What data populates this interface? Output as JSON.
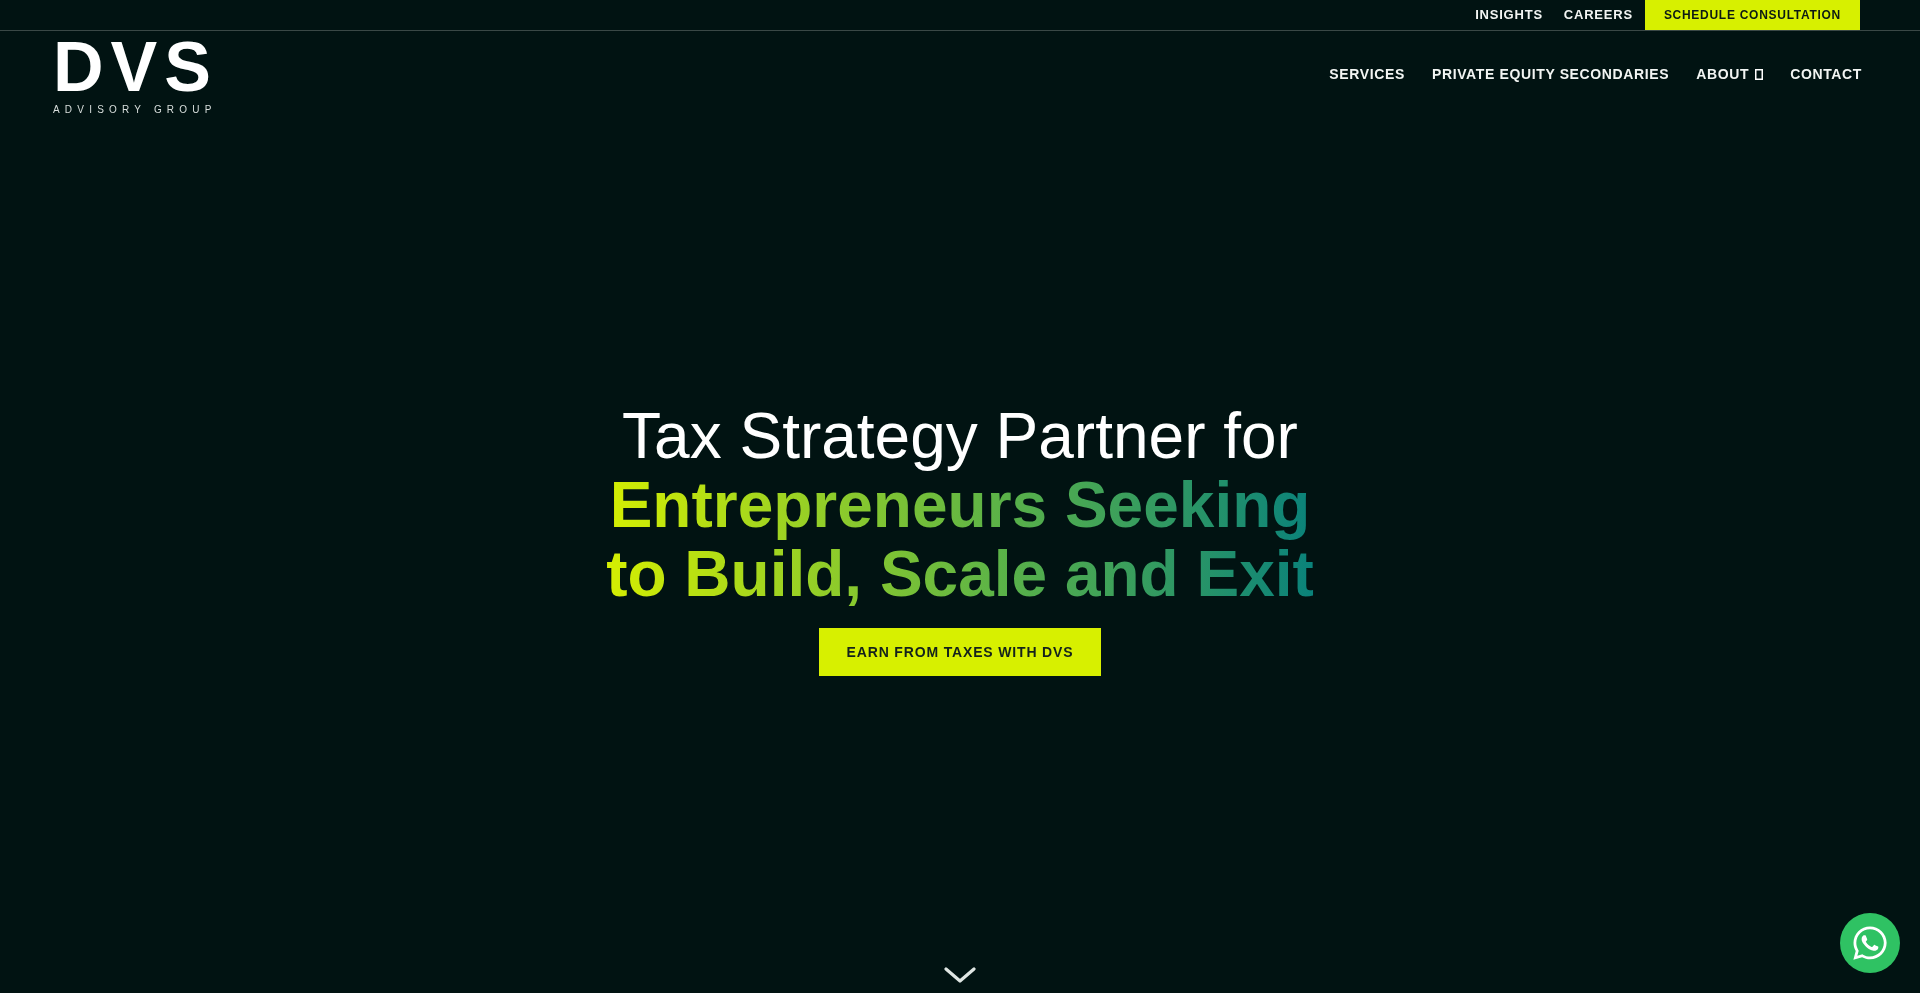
{
  "top_bar": {
    "links": [
      "INSIGHTS",
      "CAREERS"
    ],
    "cta": "SCHEDULE CONSULTATION"
  },
  "logo": {
    "mark": "DVS",
    "tagline": "ADVISORY GROUP"
  },
  "nav": {
    "items": [
      {
        "label": "SERVICES",
        "kind": "link"
      },
      {
        "label": "PRIVATE EQUITY SECONDARIES",
        "kind": "link"
      },
      {
        "label": "ABOUT",
        "kind": "dropdown"
      },
      {
        "label": "CONTACT",
        "kind": "link"
      }
    ]
  },
  "hero": {
    "heading": "Tax Strategy Partner for **Entrepreneurs Seeking to Build, Scale and Exit**",
    "button": "EARN FROM TAXES WITH DVS"
  }
}
